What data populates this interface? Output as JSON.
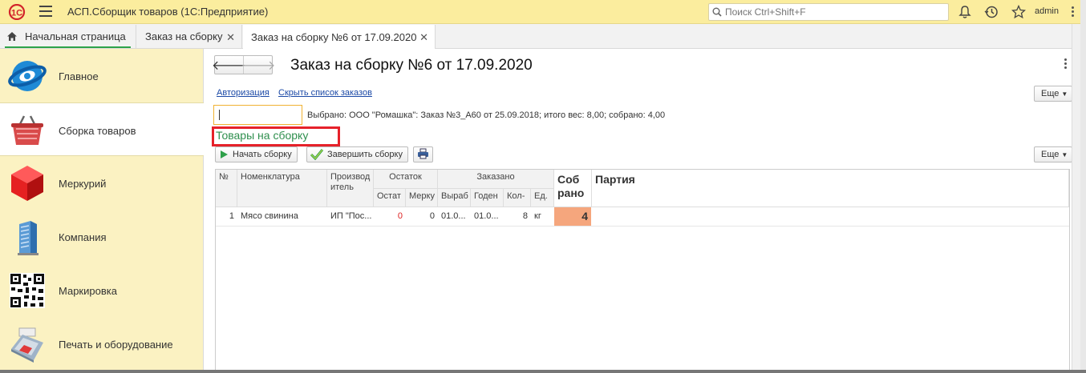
{
  "app": {
    "logo": "1С",
    "title": "АСП.Сборщик товаров  (1С:Предприятие)",
    "search_placeholder": "Поиск Ctrl+Shift+F",
    "user": "admin"
  },
  "tabs": [
    {
      "label": "Начальная страница"
    },
    {
      "label": "Заказ на сборку"
    },
    {
      "label": "Заказ на сборку №6 от 17.09.2020"
    }
  ],
  "sidebar": {
    "items": [
      {
        "label": "Главное",
        "icon": "main-globe-icon"
      },
      {
        "label": "Сборка товаров",
        "icon": "basket-icon"
      },
      {
        "label": "Меркурий",
        "icon": "red-cube-icon"
      },
      {
        "label": "Компания",
        "icon": "building-icon"
      },
      {
        "label": "Маркировка",
        "icon": "qr-code-icon"
      },
      {
        "label": "Печать и оборудование",
        "icon": "pos-terminal-icon"
      }
    ]
  },
  "form": {
    "title": "Заказ на сборку №6 от 17.09.2020",
    "links": {
      "auth": "Авторизация",
      "hide_orders": "Скрыть список заказов"
    },
    "more_label": "Еще",
    "barcode_value": "",
    "selected_info": "Выбрано: ООО \"Ромашка\": Заказ №3_А60 от 25.09.2018; итого вес: 8,00; собрано: 4,00",
    "section_title": "Товары на сборку",
    "buttons": {
      "start": "Начать сборку",
      "finish": "Завершить сборку"
    }
  },
  "table": {
    "headers": {
      "num": "№",
      "nomenclature": "Номенклатура",
      "producer": "Производ итель",
      "remain": "Остаток",
      "remain_stock": "Остат",
      "remain_mercury": "Мерку",
      "ordered": "Заказано",
      "ordered_produced": "Выраб",
      "ordered_valid": "Годен",
      "ordered_qty": "Кол-",
      "ordered_unit": "Ед.",
      "collected": "Соб рано",
      "batch": "Партия"
    },
    "rows": [
      {
        "num": "1",
        "nomenclature": "Мясо свинина",
        "producer": "ИП \"Пос...",
        "remain_stock": "0",
        "remain_mercury": "0",
        "produced": "01.0...",
        "valid": "01.0...",
        "qty": "8",
        "unit": "кг",
        "collected": "4",
        "batch": ""
      }
    ]
  }
}
